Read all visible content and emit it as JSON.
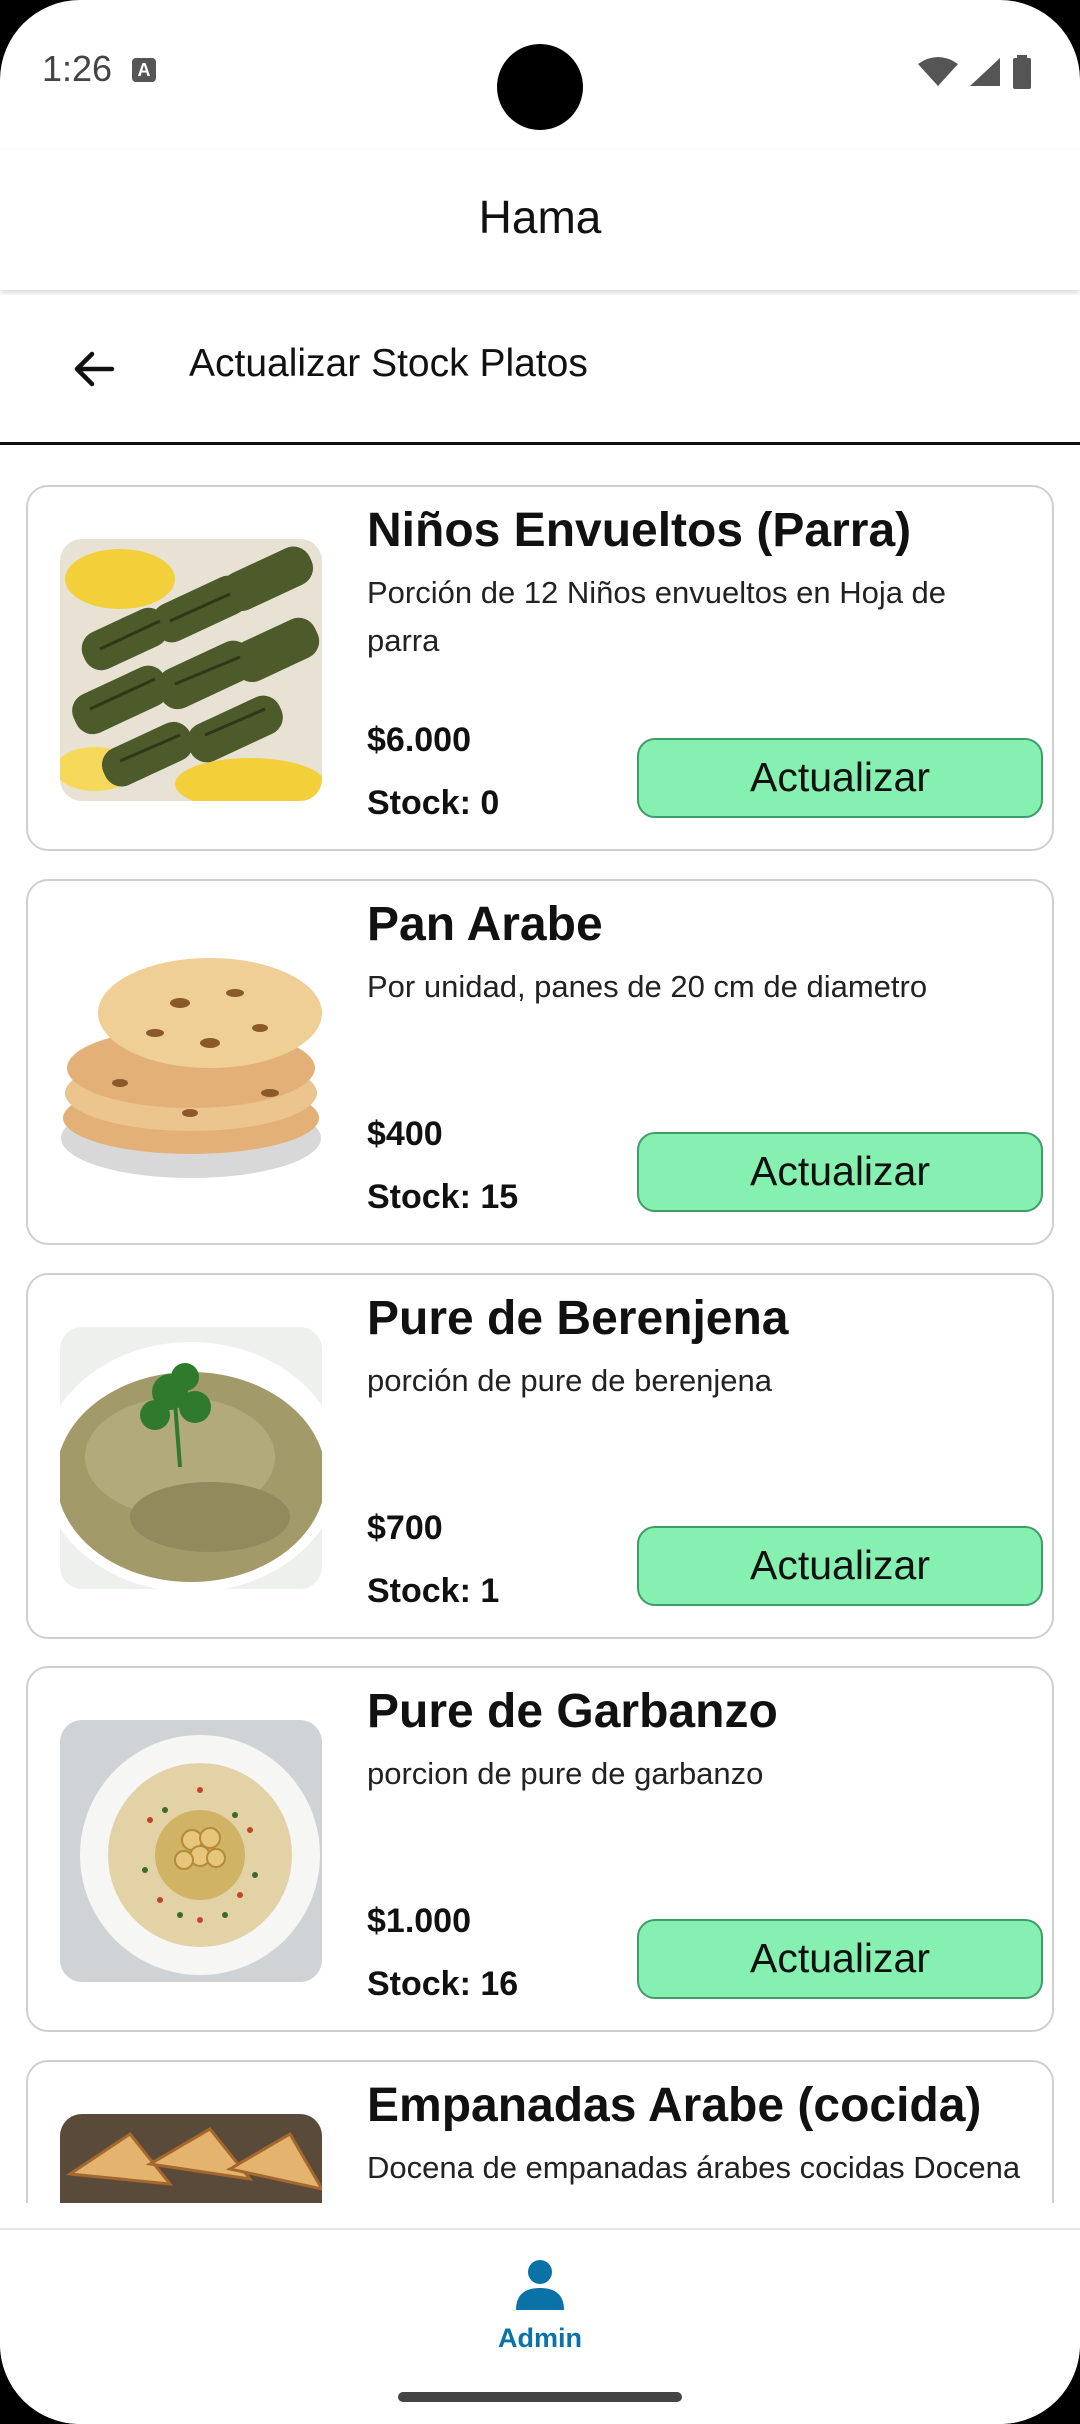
{
  "status_bar": {
    "time": "1:26"
  },
  "app": {
    "title": "Hama"
  },
  "header": {
    "title": "Actualizar Stock Platos"
  },
  "dishes": [
    {
      "name": "Niños Envueltos (Parra)",
      "description": "Porción de 12 Niños envueltos en Hoja de parra",
      "price": "$6.000",
      "stock": "Stock: 0",
      "button_label": "Actualizar"
    },
    {
      "name": "Pan Arabe",
      "description": "Por unidad, panes de 20 cm de diametro",
      "price": "$400",
      "stock": "Stock: 15",
      "button_label": "Actualizar"
    },
    {
      "name": "Pure de Berenjena",
      "description": "porción de pure de berenjena",
      "price": "$700",
      "stock": "Stock: 1",
      "button_label": "Actualizar"
    },
    {
      "name": "Pure de Garbanzo",
      "description": "porcion de pure de garbanzo",
      "price": "$1.000",
      "stock": "Stock: 16",
      "button_label": "Actualizar"
    },
    {
      "name": "Empanadas Arabe (cocida)",
      "description": "Docena de empanadas árabes cocidas Docena de empanadas árabes cocidas Docena de em",
      "price": "",
      "stock": "",
      "button_label": ""
    }
  ],
  "bottom_nav": {
    "admin_label": "Admin"
  },
  "colors": {
    "accent": "#0a72a6",
    "button": "#86f0b1"
  }
}
